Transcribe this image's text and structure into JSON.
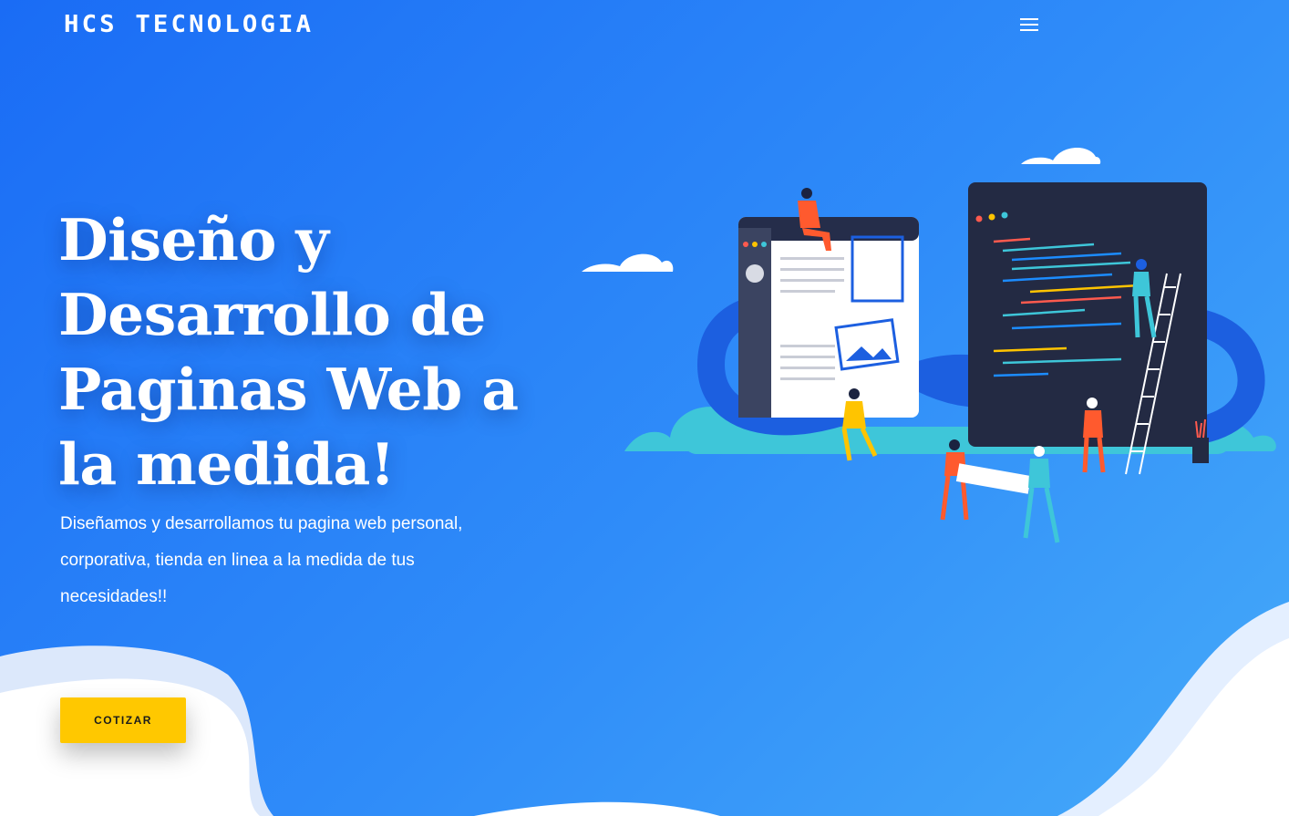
{
  "header": {
    "logo_text": "HCS TECNOLOGIA",
    "menu_icon": "hamburger-menu-icon"
  },
  "hero": {
    "title_lines": [
      "Diseño y",
      "Desarrollo de",
      "Paginas Web a",
      "la medida!"
    ],
    "subtitle_lines": [
      "Diseñamos y desarrollamos tu pagina web personal,",
      "corporativa, tienda en linea a la medida de tus",
      "necesidades!!"
    ],
    "cta_label": "COTIZAR"
  },
  "illustration": {
    "description_icon": "web-development-illustration-icon"
  },
  "colors": {
    "background_start": "#1a6cf5",
    "background_end": "#45aaf9",
    "cta": "#ffc800",
    "text": "#ffffff"
  }
}
